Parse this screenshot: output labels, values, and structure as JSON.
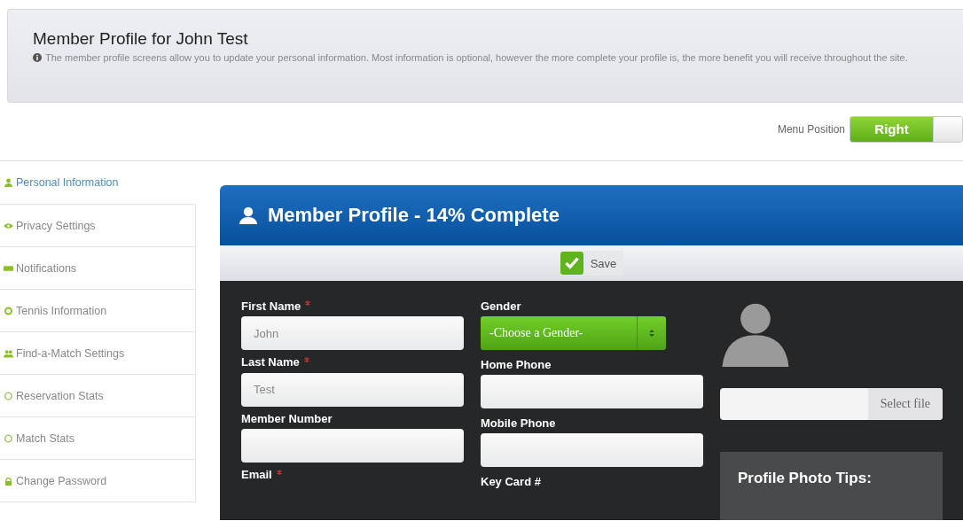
{
  "header": {
    "title": "Member Profile for John Test",
    "description": "The member profile screens allow you to update your personal information. Most information is optional, however the more complete your profile is, the more benefit you will receive throughout the site."
  },
  "menu_position": {
    "label": "Menu Position",
    "value": "Right",
    "on": true
  },
  "sidebar": {
    "items": [
      {
        "label": "Personal Information",
        "selected": true
      },
      {
        "label": "Privacy Settings",
        "selected": false
      },
      {
        "label": "Notifications",
        "selected": false
      },
      {
        "label": "Tennis Information",
        "selected": false
      },
      {
        "label": "Find-a-Match Settings",
        "selected": false
      },
      {
        "label": "Reservation Stats",
        "selected": false
      },
      {
        "label": "Match Stats",
        "selected": false
      },
      {
        "label": "Change Password",
        "selected": false
      }
    ]
  },
  "panel": {
    "title": "Member Profile - 14% Complete",
    "save": "Save",
    "columns": [
      [
        {
          "label": "First Name",
          "required": true,
          "kind": "text",
          "value": "John"
        },
        {
          "label": "Last Name",
          "required": true,
          "kind": "text",
          "value": "Test"
        },
        {
          "label": "Member Number",
          "required": false,
          "kind": "text"
        },
        {
          "label": "Email",
          "required": true,
          "kind": "label"
        }
      ],
      [
        {
          "label": "Gender",
          "required": false,
          "kind": "select",
          "value": "-Choose a Gender-"
        },
        {
          "label": "Home Phone",
          "required": false,
          "kind": "text"
        },
        {
          "label": "Mobile Phone",
          "required": false,
          "kind": "text"
        },
        {
          "label": "Key Card #",
          "required": false,
          "kind": "label"
        }
      ]
    ],
    "photo": {
      "select_file": "Select file",
      "tips_title": "Profile Photo Tips:"
    }
  }
}
